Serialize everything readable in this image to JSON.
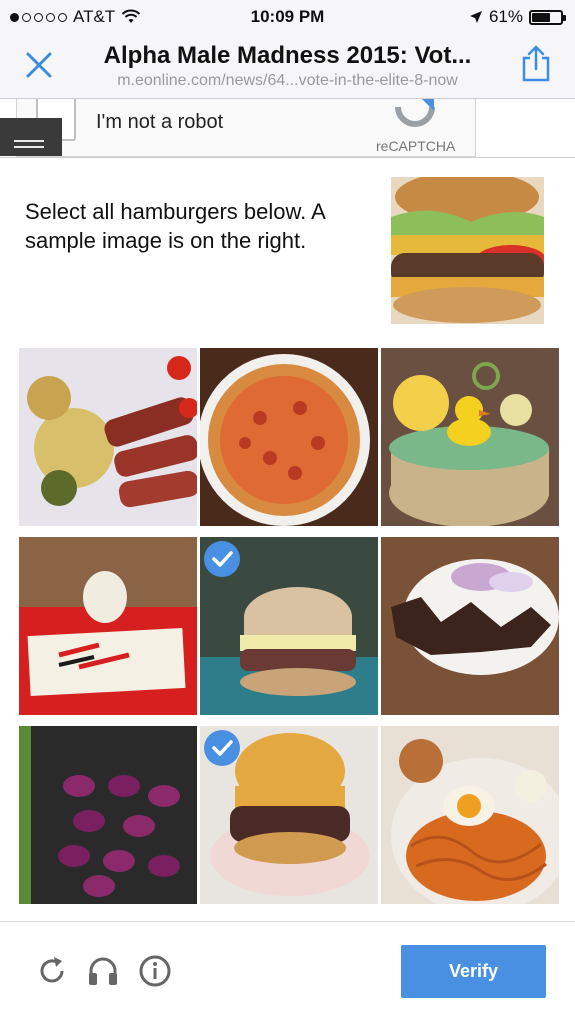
{
  "status_bar": {
    "carrier": "AT&T",
    "time": "10:09 PM",
    "battery": "61%",
    "battery_level": 0.61,
    "signal_bars": 1,
    "icons": [
      "wifi-icon",
      "location-arrow-icon",
      "battery-icon"
    ]
  },
  "browser": {
    "page_title": "Alpha Male Madness 2015: Vot...",
    "url": "m.eonline.com/news/64...vote-in-the-elite-8-now",
    "icons": [
      "close-icon",
      "share-icon"
    ]
  },
  "recaptcha": {
    "checkbox_label": "I'm not a robot",
    "brand": "reCAPTCHA"
  },
  "challenge": {
    "prompt": "Select all hamburgers below. A sample image is on the right.",
    "sample_image": "hamburger",
    "tiles": [
      {
        "image": "sliced steak with potatoes",
        "selected": false
      },
      {
        "image": "pizza",
        "selected": false
      },
      {
        "image": "cake with duck decoration",
        "selected": false
      },
      {
        "image": "decorated sheet cake",
        "selected": false
      },
      {
        "image": "hamburger",
        "selected": true
      },
      {
        "image": "grilled meat with onions",
        "selected": false
      },
      {
        "image": "eggplants in crate",
        "selected": false
      },
      {
        "image": "hamburger",
        "selected": true
      },
      {
        "image": "noodles with fried egg",
        "selected": false
      }
    ]
  },
  "footer": {
    "verify_label": "Verify",
    "icons": [
      "reload-icon",
      "headphones-icon",
      "info-icon"
    ]
  },
  "colors": {
    "accent": "#4a90e2",
    "chrome_bg": "#f6f6f8",
    "link_blue": "#3a8de0"
  }
}
